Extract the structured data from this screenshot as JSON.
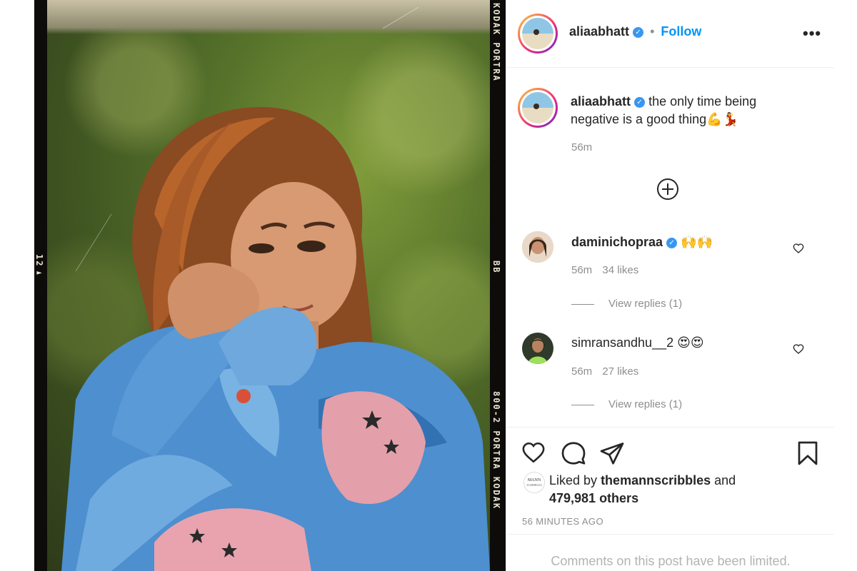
{
  "header": {
    "username": "aliaabhatt",
    "separator": "•",
    "follow_label": "Follow",
    "more_icon": "more-icon"
  },
  "caption": {
    "username": "aliaabhatt",
    "text_line1": "the only time being",
    "text_line2": "negative is a good thing💪💃",
    "time": "56m"
  },
  "load_more_icon": "plus-circle-icon",
  "comments": [
    {
      "username": "daminichopraa",
      "text": "🙌🙌",
      "time": "56m",
      "likes": "34 likes",
      "replies": "View replies (1)"
    },
    {
      "username": "simransandhu__2",
      "text": "😍😍",
      "time": "56m",
      "likes": "27 likes",
      "replies": "View replies (1)"
    }
  ],
  "actions": {
    "icons": [
      "heart-icon",
      "comment-icon",
      "share-icon",
      "bookmark-icon"
    ],
    "liked_by_prefix": "Liked by",
    "liked_by_user": "themannscribbles",
    "liked_by_and": "and",
    "others": "479,981 others",
    "timestamp": "56 MINUTES AGO"
  },
  "footer": {
    "limited_text": "Comments on this post have been limited."
  },
  "film": {
    "top_text": "KODAK PORTRA",
    "left_number": "12►",
    "right_mid": "BB",
    "right_bottom": "800-2 PORTRA KODAK"
  },
  "colors": {
    "accent": "#0095f6",
    "verified": "#3897f0",
    "text": "#262626",
    "muted": "#8e8e8e"
  }
}
